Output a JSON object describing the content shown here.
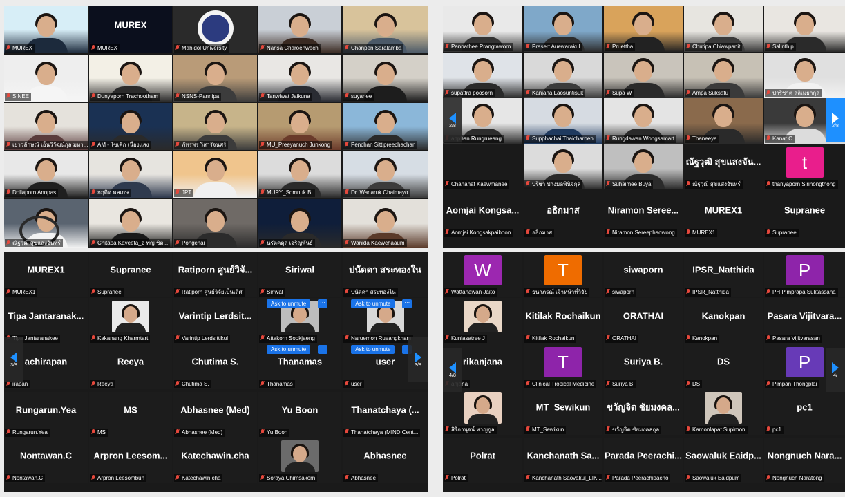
{
  "panel1": {
    "tiles": [
      {
        "name": "MUREX",
        "big": "",
        "scene": [
          "#d7eef7",
          "#1c2a3c"
        ],
        "person": true
      },
      {
        "name": "MUREX",
        "big": "MUREX",
        "scene": [
          "#0b0f1d",
          "#0b0f1d"
        ],
        "person": false
      },
      {
        "name": "Mahidol University",
        "big": "",
        "scene": [
          "#2a2a2a",
          "#2a2a2a"
        ],
        "person": false,
        "emblem": true
      },
      {
        "name": "Narisa Charoenwech",
        "big": "",
        "scene": [
          "#c9cfd6",
          "#3a2a22"
        ],
        "person": true
      },
      {
        "name": "Chanpen Saralamba",
        "big": "",
        "scene": [
          "#d8c39b",
          "#4b5968"
        ],
        "person": true
      },
      {
        "name": "SINEE",
        "big": "",
        "scene": [
          "#eeeeee",
          "#f5f5f5"
        ],
        "person": true
      },
      {
        "name": "Dunyaporn Trachootham",
        "big": "",
        "scene": [
          "#f3f0e6",
          "#2b2b2b"
        ],
        "person": true
      },
      {
        "name": "NSNS-Pannipa",
        "big": "",
        "scene": [
          "#b99b78",
          "#3c3c3c"
        ],
        "person": true
      },
      {
        "name": "Tanwiwat Jaikuna",
        "big": "",
        "scene": [
          "#e9e7e4",
          "#2a2c33"
        ],
        "person": true
      },
      {
        "name": "suyanee",
        "big": "",
        "scene": [
          "#d4d0c8",
          "#1d1d1d"
        ],
        "person": true
      },
      {
        "name": "เยาวลักษณ์ เอ็นวิวัฒน์กุล มหา...",
        "big": "",
        "scene": [
          "#e5e2dc",
          "#5a3c3c"
        ],
        "person": true
      },
      {
        "name": "AM - ไซเคีก เนื่องแสง",
        "big": "",
        "scene": [
          "#1a3153",
          "#2a2a2a"
        ],
        "person": true
      },
      {
        "name": "ภัทรพร วิสารัจนศร์",
        "big": "",
        "scene": [
          "#c7b48a",
          "#3b3b3b"
        ],
        "person": true
      },
      {
        "name": "MU_Preeyanuch Junkong",
        "big": "",
        "scene": [
          "#b69b71",
          "#6a3a2a"
        ],
        "person": true
      },
      {
        "name": "Penchan Sittipreechachan",
        "big": "",
        "scene": [
          "#8bb7d9",
          "#2a2a2a"
        ],
        "person": true
      },
      {
        "name": "Dollaporn Anopas",
        "big": "",
        "scene": [
          "#e8e8e8",
          "#1f1f1f"
        ],
        "person": true
      },
      {
        "name": "กฤติด พลเกษ",
        "big": "",
        "scene": [
          "#e6e4df",
          "#2f3a4e"
        ],
        "person": true
      },
      {
        "name": "JPT",
        "big": "",
        "scene": [
          "#f0c58d",
          "#f0f0f0"
        ],
        "person": true
      },
      {
        "name": "MUPY_Somnuk B.",
        "big": "",
        "scene": [
          "#dcdcdc",
          "#2a2a2a"
        ],
        "person": true
      },
      {
        "name": "Dr. Wanaruk Chaimayo",
        "big": "",
        "scene": [
          "#d6dde4",
          "#3c3c3c"
        ],
        "person": true
      },
      {
        "name": "ณัฐวุฒิ สุขแสงจันทร์",
        "big": "",
        "scene": [
          "#5a6470",
          "#f3f3f3"
        ],
        "person": true,
        "car": true
      },
      {
        "name": "Chitapa Kaveeta_อ พญ ชิต...",
        "big": "",
        "scene": [
          "#e9e6e0",
          "#1a1a1a"
        ],
        "person": true
      },
      {
        "name": "Pongchai",
        "big": "",
        "scene": [
          "#6f6a66",
          "#2b2b2b"
        ],
        "person": true
      },
      {
        "name": "นรัตคดุล เจริญพันธ์",
        "big": "",
        "scene": [
          "#0f1e3a",
          "#2a2a2a"
        ],
        "person": true
      },
      {
        "name": "Wanida Kaewchaaum",
        "big": "",
        "scene": [
          "#e3e0da",
          "#5a3a2a"
        ],
        "person": true
      }
    ]
  },
  "panel2": {
    "rows": [
      [
        {
          "name": "Pannathee Prangtaworn",
          "big": "",
          "scene": [
            "#e9e9e9",
            "#333333"
          ],
          "person": true
        },
        {
          "name": "Prasert Auewarakul",
          "big": "",
          "scene": [
            "#7fa8c9",
            "#2c2c2c"
          ],
          "person": true
        },
        {
          "name": "Pruettha",
          "big": "",
          "scene": [
            "#d9a35b",
            "#222222"
          ],
          "person": true
        },
        {
          "name": "Chutipa Chiawpanit",
          "big": "",
          "scene": [
            "#e7e5e0",
            "#3a3a3a"
          ],
          "person": true
        },
        {
          "name": "Salinthip",
          "big": "",
          "scene": [
            "#e9e6e1",
            "#2a2a2a"
          ],
          "person": true
        }
      ],
      [
        {
          "name": "supattra poosorn",
          "big": "",
          "scene": [
            "#dfe3e8",
            "#2a2a2a"
          ],
          "person": true
        },
        {
          "name": "Kanjana Laosuntisuk",
          "big": "",
          "scene": [
            "#d9d9d9",
            "#3b3b3b"
          ],
          "person": true
        },
        {
          "name": "Supa W",
          "big": "",
          "scene": [
            "#c9c4bb",
            "#2a2a2a"
          ],
          "person": true
        },
        {
          "name": "Ampa Suksatu",
          "big": "",
          "scene": [
            "#c7c1b5",
            "#3a3a3a"
          ],
          "person": true
        },
        {
          "name": "ปาริชาต ลลิเมธากุล",
          "big": "",
          "scene": [
            "#e0e0e0",
            "#f2f2f2"
          ],
          "person": true
        }
      ],
      [
        {
          "name": "anphan Rungrueang",
          "big": "",
          "scene": [
            "#e6e6e6",
            "#2c2c2c"
          ],
          "person": true
        },
        {
          "name": "Supphachai Thaicharoen",
          "big": "",
          "scene": [
            "#d6dbe2",
            "#1f3a5f"
          ],
          "person": true
        },
        {
          "name": "Rungdawan Wongsamart",
          "big": "",
          "scene": [
            "#e4e4e4",
            "#2a2a2a"
          ],
          "person": true
        },
        {
          "name": "Thaneeya",
          "big": "",
          "scene": [
            "#8a6a4c",
            "#2a2a2a"
          ],
          "person": true
        },
        {
          "name": "Kanat C",
          "big": "",
          "scene": [
            "#3a3a3a",
            "#dcdcdc"
          ],
          "person": true
        }
      ],
      [
        {
          "name": "Chananat Kaewmanee",
          "big": "",
          "scene": [
            "#1a1a1a",
            "#1a1a1a"
          ],
          "person": false
        },
        {
          "name": "ปรีชา ปางมลพินิจกุล",
          "big": "",
          "scene": [
            "#dcdcdc",
            "#2a2a2a"
          ],
          "person": true
        },
        {
          "name": "Suhaimee Buya",
          "big": "",
          "scene": [
            "#bfbfbf",
            "#2a2a2a"
          ],
          "person": true
        },
        {
          "name": "ณัฐวุฒิ สุขแสงจันทร์",
          "big": "ณัฐวุฒิ สุขแสงจัน...",
          "scene": [
            "#1a1a1a",
            "#1a1a1a"
          ],
          "person": false
        },
        {
          "name": "thanyaporn Sirihongthong",
          "big": "",
          "scene": [
            "#1a1a1a",
            "#1a1a1a"
          ],
          "person": false,
          "avatar": "t",
          "avatarColor": "#e91e8c"
        }
      ],
      [
        {
          "name": "Aomjai Kongsakpaiboon",
          "big": "Aomjai Kongsa...",
          "scene": [
            "#1a1a1a",
            "#1a1a1a"
          ],
          "person": false
        },
        {
          "name": "อธิกมาส",
          "big": "อธิกมาส",
          "scene": [
            "#1a1a1a",
            "#1a1a1a"
          ],
          "person": false
        },
        {
          "name": "Niramon Sereephaowong",
          "big": "Niramon Seree...",
          "scene": [
            "#1a1a1a",
            "#1a1a1a"
          ],
          "person": false
        },
        {
          "name": "MUREX1",
          "big": "MUREX1",
          "scene": [
            "#1a1a1a",
            "#1a1a1a"
          ],
          "person": false
        },
        {
          "name": "Supranee",
          "big": "Supranee",
          "scene": [
            "#1a1a1a",
            "#1a1a1a"
          ],
          "person": false
        }
      ]
    ],
    "nav_left_page": "2/8",
    "nav_right_page": "2/8"
  },
  "panel3": {
    "rows": [
      [
        {
          "name": "MUREX1",
          "big": "MUREX1"
        },
        {
          "name": "Supranee",
          "big": "Supranee"
        },
        {
          "name": "Ratiporn ศูนย์วิจัยเป็นเลิศ",
          "big": "Ratiporn ศูนย์วิจั..."
        },
        {
          "name": "Siriwal",
          "big": "Siriwal"
        },
        {
          "name": "ปนัดดา สระทองไน",
          "big": "ปนัดดา สระทองใน"
        }
      ],
      [
        {
          "name": "Tipa Jantaranakee",
          "big": "Tipa Jantaranak..."
        },
        {
          "name": "Kakanang Kharmtart",
          "big": "",
          "photo": "#eaeaea"
        },
        {
          "name": "Varintip Lerdsittikul",
          "big": "Varintip Lerdsit..."
        },
        {
          "name": "Attakorn Sookjaeng",
          "big": "",
          "photo": "#bdbdbd",
          "ask": true
        },
        {
          "name": "Naruemon Rueangkham",
          "big": "",
          "photo": "#d8d8d8",
          "ask": true
        }
      ],
      [
        {
          "name": "irapan",
          "big": "achirapan"
        },
        {
          "name": "Reeya",
          "big": "Reeya"
        },
        {
          "name": "Chutima S.",
          "big": "Chutima S."
        },
        {
          "name": "Thanamas",
          "big": "Thanamas",
          "ask": true
        },
        {
          "name": "user",
          "big": "user",
          "ask": true
        }
      ],
      [
        {
          "name": "Rungarun.Yea",
          "big": "Rungarun.Yea"
        },
        {
          "name": "MS",
          "big": "MS"
        },
        {
          "name": "Abhasnee (Med)",
          "big": "Abhasnee (Med)"
        },
        {
          "name": "Yu Boon",
          "big": "Yu Boon"
        },
        {
          "name": "Thanatchaya (MIND Cent...",
          "big": "Thanatchaya (..."
        }
      ],
      [
        {
          "name": "Nontawan.C",
          "big": "Nontawan.C"
        },
        {
          "name": "Arpron Leesombun",
          "big": "Arpron Leesom..."
        },
        {
          "name": "Katechawin.cha",
          "big": "Katechawin.cha"
        },
        {
          "name": "Soraya Chimsakorn",
          "big": "",
          "photo": "#6b6b6b"
        },
        {
          "name": "Abhasnee",
          "big": "Abhasnee"
        }
      ]
    ],
    "ask_label": "Ask to unmute",
    "more_label": "···",
    "nav_left_page": "3/8",
    "nav_right_page": "3/8"
  },
  "panel4": {
    "rows": [
      [
        {
          "name": "Wattanawan Jaito",
          "big": "",
          "avatar": "W",
          "avatarColor": "#9c27b0"
        },
        {
          "name": "ธนาภรณ์ เจ้าหน้าที่วิจัย",
          "big": "",
          "avatar": "T",
          "avatarColor": "#ef6c00"
        },
        {
          "name": "siwaporn",
          "big": "siwaporn"
        },
        {
          "name": "IPSR_Natthida",
          "big": "IPSR_Natthida"
        },
        {
          "name": "PH Pimprapa Suktassana",
          "big": "",
          "avatar": "P",
          "avatarColor": "#8e24aa"
        }
      ],
      [
        {
          "name": "Kunlasatree J",
          "big": "",
          "photo": "#e9d7c7"
        },
        {
          "name": "Kitilak Rochaikun",
          "big": "Kitilak Rochaikun"
        },
        {
          "name": "ORATHAI",
          "big": "ORATHAI"
        },
        {
          "name": "Kanokpan",
          "big": "Kanokpan"
        },
        {
          "name": "Pasara Vijitvarasan",
          "big": "Pasara Vijitvara..."
        }
      ],
      [
        {
          "name": "anjana",
          "big": "rikanjana"
        },
        {
          "name": "Clinical Tropical Medicine",
          "big": "",
          "avatar": "T",
          "avatarColor": "#8e24aa"
        },
        {
          "name": "Suriya B.",
          "big": "Suriya B."
        },
        {
          "name": "DS",
          "big": "DS"
        },
        {
          "name": "Pimpan Thongplai",
          "big": "",
          "avatar": "P",
          "avatarColor": "#673ab7"
        }
      ],
      [
        {
          "name": "สิริกานุจน์ หาญกูล",
          "big": "",
          "photo": "#e8d0c0"
        },
        {
          "name": "MT_Sewikun",
          "big": "MT_Sewikun"
        },
        {
          "name": "ขวัญจิต ชัยมงคลกุล",
          "big": "ขวัญจิต ชัยมงคล..."
        },
        {
          "name": "Kamonlapat Supimon",
          "big": "",
          "photo": "#cfc6bb"
        },
        {
          "name": "pc1",
          "big": "pc1"
        }
      ],
      [
        {
          "name": "Polrat",
          "big": "Polrat"
        },
        {
          "name": "Kanchanath Saovakul_LIK...",
          "big": "Kanchanath Sa..."
        },
        {
          "name": "Parada Peerachidacho",
          "big": "Parada Peerachi..."
        },
        {
          "name": "Saowaluk Eaidpum",
          "big": "Saowaluk Eaidp..."
        },
        {
          "name": "Nongnuch Naratong",
          "big": "Nongnuch Nara..."
        }
      ]
    ],
    "nav_left_page": "4/8",
    "nav_right_page": "4/"
  },
  "colors": {
    "accent": "#1e90ff",
    "muted_mic": "#e5483c",
    "tile_bg": "#1c1c1c"
  }
}
